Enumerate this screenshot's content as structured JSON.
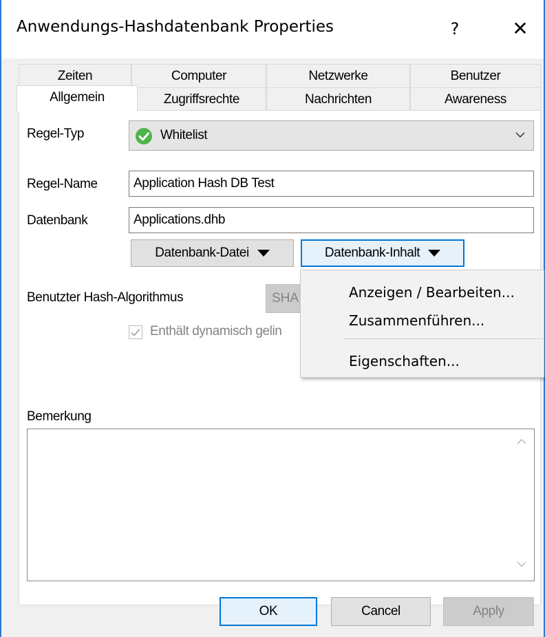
{
  "window": {
    "title": "Anwendungs-Hashdatenbank Properties",
    "help_glyph": "?",
    "close_glyph": "✕"
  },
  "tabs": {
    "row1": [
      "Zeiten",
      "Computer",
      "Netzwerke",
      "Benutzer"
    ],
    "row2": [
      "Allgemein",
      "Zugriffsrechte",
      "Nachrichten",
      "Awareness"
    ],
    "selected": "Allgemein"
  },
  "form": {
    "rule_type_label": "Regel-Typ",
    "rule_type_value": "Whitelist",
    "rule_name_label": "Regel-Name",
    "rule_name_value": "Application Hash DB Test",
    "database_label": "Datenbank",
    "database_value": "Applications.dhb",
    "db_file_button": "Datenbank-Datei",
    "db_content_button": "Datenbank-Inhalt",
    "hash_algo_label": "Benutzter Hash-Algorithmus",
    "hash_algo_value": "SHA",
    "dynamic_checkbox_label": "Enthält dynamisch gelin",
    "dynamic_checked": true,
    "remarks_label": "Bemerkung",
    "remarks_value": ""
  },
  "context_menu": {
    "items": [
      "Anzeigen / Bearbeiten...",
      "Zusammenführen...",
      "Eigenschaften..."
    ]
  },
  "footer": {
    "ok": "OK",
    "cancel": "Cancel",
    "apply": "Apply"
  },
  "colors": {
    "accent": "#0078d7",
    "check_green": "#4fb44b",
    "disabled_text": "#838383"
  }
}
